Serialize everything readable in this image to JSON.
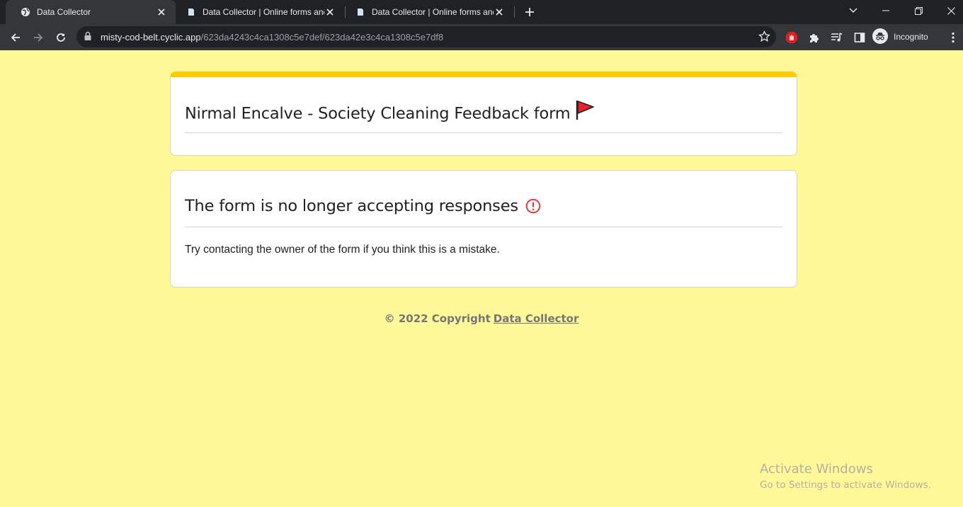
{
  "browser": {
    "tabs": [
      {
        "title": "Data Collector",
        "active": true
      },
      {
        "title": "Data Collector | Online forms and",
        "active": false
      },
      {
        "title": "Data Collector | Online forms and",
        "active": false
      }
    ],
    "url_host": "misty-cod-belt.cyclic.app",
    "url_path": "/623da4243c4ca1308c5e7def/623da42e3c4ca1308c5e7df8",
    "profile_label": "Incognito"
  },
  "form": {
    "title": "Nirmal Encalve - Society Cleaning Feedback form",
    "accent_color": "#ffcc00"
  },
  "notice": {
    "heading": "The form is no longer accepting responses",
    "message": "Try contacting the owner of the form if you think this is a mistake."
  },
  "footer": {
    "copyright": "© 2022 Copyright",
    "link": "Data Collector"
  },
  "watermark": {
    "line1": "Activate Windows",
    "line2": "Go to Settings to activate Windows."
  },
  "colors": {
    "page_background": "#fff899",
    "alert": "#e53935"
  }
}
